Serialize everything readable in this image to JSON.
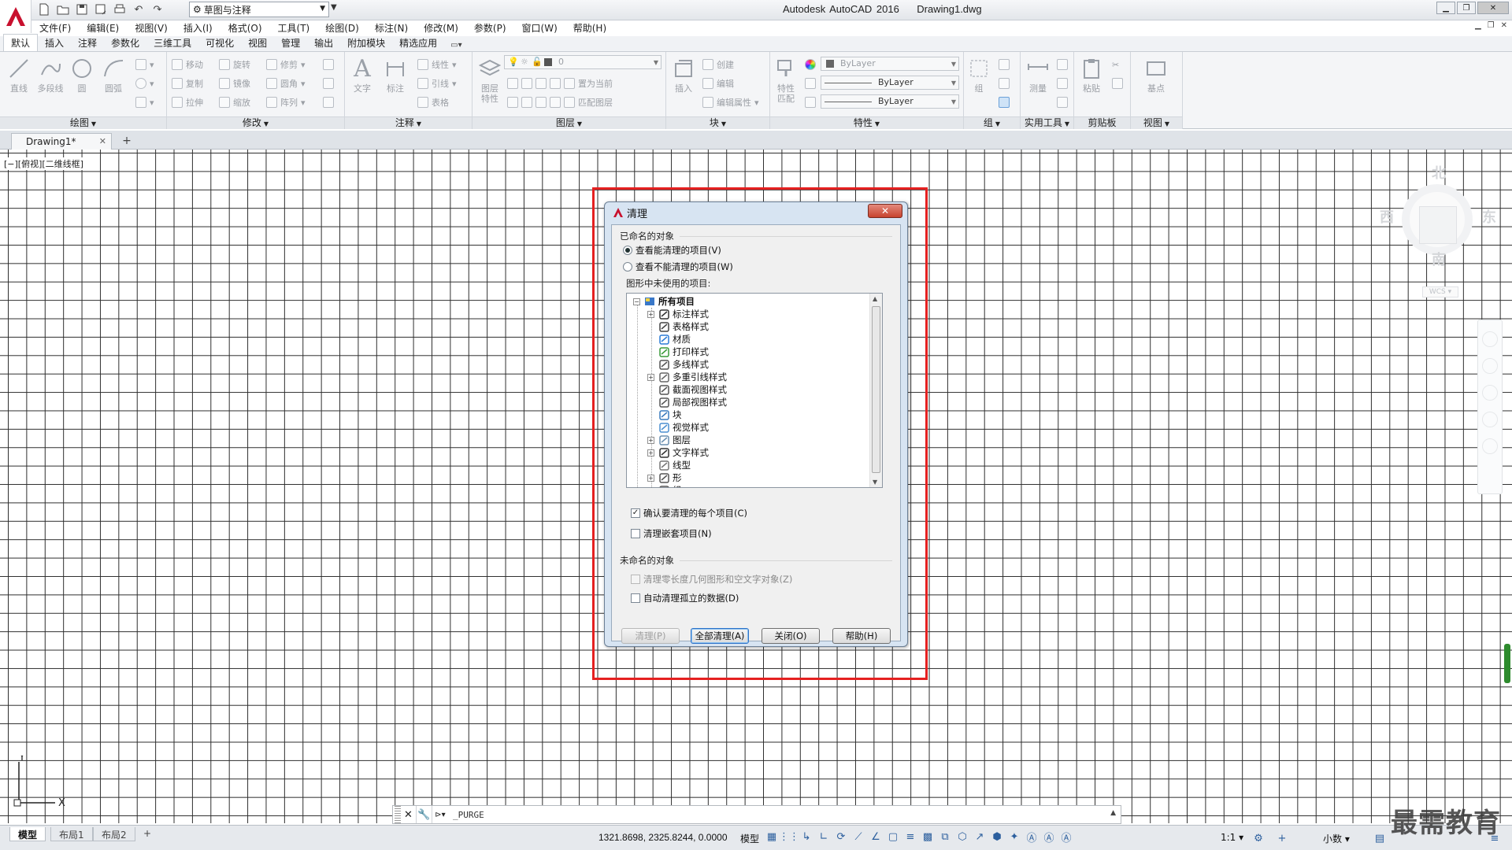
{
  "title_bar": {
    "workspace": "草图与注释",
    "app_name": "Autodesk AutoCAD 2016",
    "file_name": "Drawing1.dwg"
  },
  "menu": [
    "文件(F)",
    "编辑(E)",
    "视图(V)",
    "插入(I)",
    "格式(O)",
    "工具(T)",
    "绘图(D)",
    "标注(N)",
    "修改(M)",
    "参数(P)",
    "窗口(W)",
    "帮助(H)"
  ],
  "ribbon_tabs": [
    "默认",
    "插入",
    "注释",
    "参数化",
    "三维工具",
    "可视化",
    "视图",
    "管理",
    "输出",
    "附加模块",
    "精选应用"
  ],
  "ribbon": {
    "draw": {
      "title": "绘图",
      "buttons": [
        "直线",
        "多段线",
        "圆",
        "圆弧"
      ]
    },
    "modify": {
      "title": "修改",
      "rows": [
        [
          "移动",
          "旋转",
          "修剪"
        ],
        [
          "复制",
          "镜像",
          "圆角"
        ],
        [
          "拉伸",
          "缩放",
          "阵列"
        ]
      ]
    },
    "annotation": {
      "title": "注释",
      "buttons": [
        "文字",
        "标注"
      ],
      "rows": [
        "线性",
        "引线",
        "表格"
      ]
    },
    "layers": {
      "title": "图层",
      "big": "图层\n特性",
      "current_layer": "0",
      "rows": [
        "置为当前",
        "匹配图层"
      ]
    },
    "block": {
      "title": "块",
      "big": "插入",
      "rows": [
        "创建",
        "编辑",
        "编辑属性"
      ]
    },
    "properties": {
      "title": "特性",
      "big": "特性\n匹配",
      "color": "ByLayer",
      "linetype": "ByLayer",
      "lineweight": "ByLayer"
    },
    "groups": {
      "title": "组",
      "big": "组"
    },
    "utilities": {
      "title": "实用工具",
      "big": "测量"
    },
    "clipboard": {
      "title": "剪贴板",
      "big": "粘贴"
    },
    "view": {
      "title": "视图",
      "big": "基点"
    }
  },
  "doc_tab": "Drawing1*",
  "viewport_label": "[−][俯视][二维线框]",
  "viewcube": {
    "north": "北",
    "south": "南",
    "east": "东",
    "west": "西",
    "wcs": "WCS"
  },
  "dialog": {
    "title": "清理",
    "named_group": "已命名的对象",
    "radio_can_purge": "查看能清理的项目(V)",
    "radio_cannot_purge": "查看不能清理的项目(W)",
    "tree_label": "图形中未使用的项目:",
    "tree_root": "所有项目",
    "tree_items": [
      {
        "label": "标注样式",
        "icon": "dimstyle-icon",
        "expandable": true
      },
      {
        "label": "表格样式",
        "icon": "tablestyle-icon",
        "expandable": false
      },
      {
        "label": "材质",
        "icon": "material-icon",
        "expandable": false
      },
      {
        "label": "打印样式",
        "icon": "plotstyle-icon",
        "expandable": false
      },
      {
        "label": "多线样式",
        "icon": "mlinestyle-icon",
        "expandable": false
      },
      {
        "label": "多重引线样式",
        "icon": "mleaderstyle-icon",
        "expandable": true
      },
      {
        "label": "截面视图样式",
        "icon": "sectionview-icon",
        "expandable": false
      },
      {
        "label": "局部视图样式",
        "icon": "detailview-icon",
        "expandable": false
      },
      {
        "label": "块",
        "icon": "block-icon",
        "expandable": false
      },
      {
        "label": "视觉样式",
        "icon": "visualstyle-icon",
        "expandable": false
      },
      {
        "label": "图层",
        "icon": "layer-icon",
        "expandable": true
      },
      {
        "label": "文字样式",
        "icon": "textstyle-icon",
        "expandable": true
      },
      {
        "label": "线型",
        "icon": "linetype-icon",
        "expandable": false
      },
      {
        "label": "形",
        "icon": "shape-icon",
        "expandable": true
      },
      {
        "label": "组",
        "icon": "group-icon",
        "expandable": false
      }
    ],
    "confirm_each": "确认要清理的每个项目(C)",
    "confirm_each_checked": true,
    "purge_nested": "清理嵌套项目(N)",
    "unnamed_group": "未命名的对象",
    "zero_length": "清理零长度几何图形和空文字对象(Z)",
    "orphaned_data": "自动清理孤立的数据(D)",
    "btn_purge": "清理(P)",
    "btn_purge_all": "全部清理(A)",
    "btn_close": "关闭(O)",
    "btn_help": "帮助(H)"
  },
  "command_line": {
    "text": "_PURGE"
  },
  "status": {
    "layouts": [
      "模型",
      "布局1",
      "布局2"
    ],
    "coords": "1321.8698, 2325.8244, 0.0000",
    "model": "模型",
    "scale": "1:1",
    "units": "小数"
  },
  "watermark": "最需教育",
  "colors": {
    "accent_red": "#e52020",
    "dialog_bg": "#d7e4f2",
    "status_green": "#2e8b2e"
  }
}
